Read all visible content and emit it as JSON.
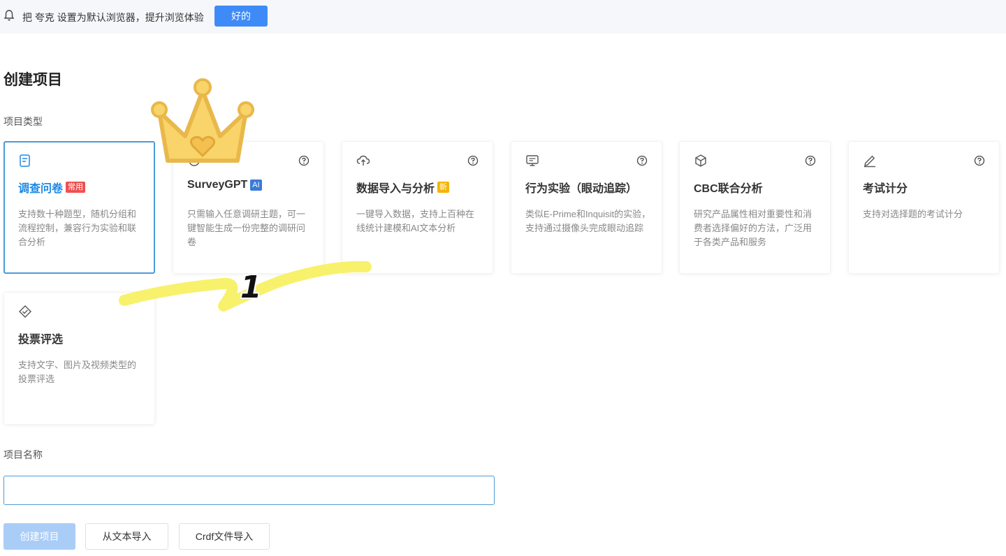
{
  "notice": {
    "text": "把 夸克 设置为默认浏览器，提升浏览体验",
    "ok_label": "好的",
    "icon": "bell-icon"
  },
  "page": {
    "title": "创建项目",
    "type_label": "项目类型",
    "name_label": "项目名称"
  },
  "cards": [
    {
      "title": "调查问卷",
      "tag": "常用",
      "tag_color": "#f05050",
      "icon": "survey-icon",
      "desc": "支持数十种题型，随机分组和流程控制，兼容行为实验和联合分析",
      "selected": true
    },
    {
      "title": "SurveyGPT",
      "tag": "AI",
      "tag_color": "#3a7bd5",
      "icon": "ai-icon",
      "desc": "只需输入任意调研主题，可一键智能生成一份完整的调研问卷",
      "selected": false
    },
    {
      "title": "数据导入与分析",
      "tag": "新",
      "tag_color": "#f5b400",
      "icon": "cloud-upload-icon",
      "desc": "一键导入数据，支持上百种在线统计建模和AI文本分析",
      "selected": false
    },
    {
      "title": "行为实验（眼动追踪）",
      "tag": "",
      "icon": "monitor-icon",
      "desc": "类似E-Prime和Inquisit的实验，支持通过摄像头完成眼动追踪",
      "selected": false
    },
    {
      "title": "CBC联合分析",
      "tag": "",
      "icon": "cube-icon",
      "desc": "研究产品属性相对重要性和消费者选择偏好的方法，广泛用于各类产品和服务",
      "selected": false
    },
    {
      "title": "考试计分",
      "tag": "",
      "icon": "pencil-icon",
      "desc": "支持对选择题的考试计分",
      "selected": false
    },
    {
      "title": "投票评选",
      "tag": "",
      "icon": "vote-icon",
      "desc": "支持文字、图片及视频类型的投票评选",
      "selected": false
    }
  ],
  "input": {
    "value": "",
    "placeholder": ""
  },
  "buttons": {
    "create": "创建项目",
    "text_import": "从文本导入",
    "crdf_import": "Crdf文件导入"
  },
  "overlay": {
    "number": "1"
  },
  "colors": {
    "primary": "#3e8bf7",
    "selected_border": "#4c9ad6",
    "highlight": "#f7f060",
    "crown": "#f6cc63"
  }
}
